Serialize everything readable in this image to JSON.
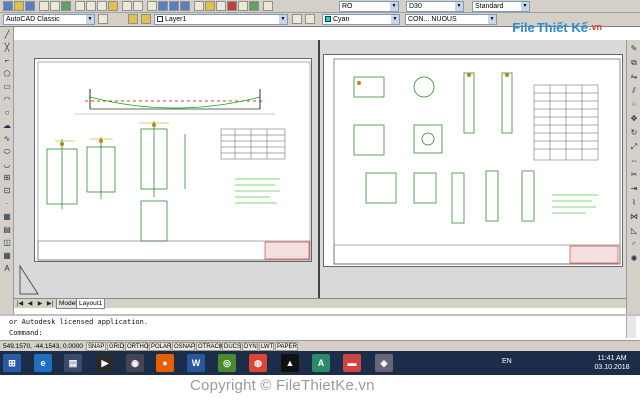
{
  "toolbar": {
    "workspace": "AutoCAD Classic",
    "layer": "Layer1",
    "color": "Cyan",
    "linetype": "CON... NUOUS",
    "text_style": "RO",
    "dim_style": "D30",
    "table_style": "Standard"
  },
  "logo": {
    "part1": "File",
    "part2": "Thiết Kế",
    "part3": ".vn"
  },
  "tabs": {
    "model": "Model",
    "layout": "Layout1"
  },
  "command": {
    "history": "or Autodesk licensed application.",
    "prompt": "Command:"
  },
  "status": {
    "coords": "549.1570, -44.1543, 0.0000",
    "buttons": [
      "SNAP",
      "GRID",
      "ORTHO",
      "POLAR",
      "OSNAP",
      "OTRACK",
      "DUCS",
      "DYN",
      "LWT",
      "PAPER"
    ]
  },
  "taskbar": {
    "lang": "EN",
    "time": "11:41 AM",
    "date": "03.10.2018"
  },
  "footer": {
    "copyright": "Copyright © FileThietKe.vn"
  },
  "colors": {
    "accent": "#2b8ad1",
    "logo_red": "#d93a2b",
    "taskbar": "#1c2d4a",
    "drawing_bg": "#d9d9d9"
  }
}
